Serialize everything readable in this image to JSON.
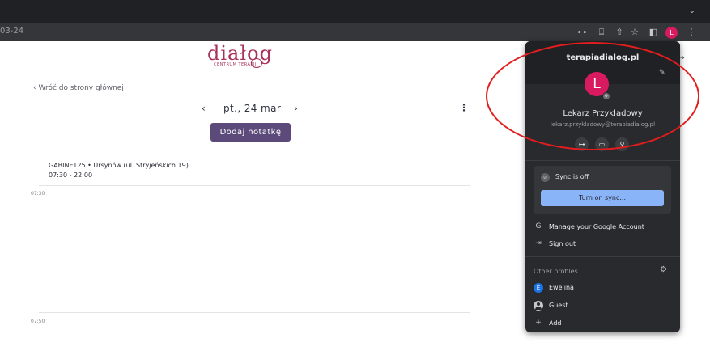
{
  "browser": {
    "url_fragment": "03-24",
    "tabstrip_chevron": "⌄",
    "avatar_letter": "L"
  },
  "site": {
    "logo_text": "diałog",
    "logo_subtitle": "CENTRUM TERAPII"
  },
  "schedule": {
    "back_link": "‹ Wróć do strony głównej",
    "prev": "‹",
    "date": "pt., 24 mar",
    "next": "›",
    "more": "⋮",
    "add_note": "Dodaj notatkę",
    "location": "GABINET25 • Ursynów (ul. Stryjeńskich 19)",
    "hours": "07:30 - 22:00",
    "slots": [
      "07:30",
      "07:50"
    ]
  },
  "profile_menu": {
    "domain": "terapiadialog.pl",
    "avatar_letter": "L",
    "user_name": "Lekarz Przykładowy",
    "user_email": "lekarz.przykladowy@terapiadialog.pl",
    "sync_status": "Sync is off",
    "sync_button": "Turn on sync...",
    "items": [
      {
        "icon": "G",
        "label": "Manage your Google Account"
      },
      {
        "icon": "⇥",
        "label": "Sign out"
      }
    ],
    "other_profiles_label": "Other profiles",
    "profiles": [
      {
        "initial": "E",
        "label": "Ewelina"
      },
      {
        "label": "Guest"
      },
      {
        "icon": "+",
        "label": "Add"
      }
    ]
  }
}
